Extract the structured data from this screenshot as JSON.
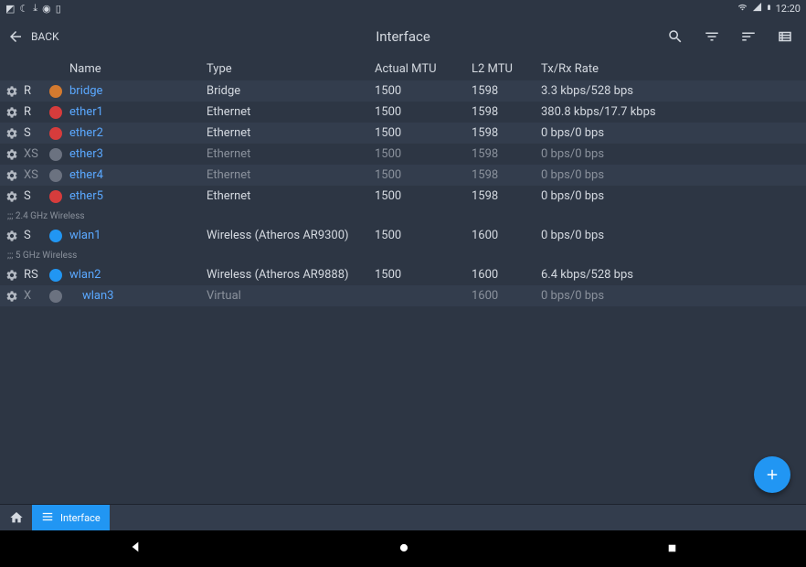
{
  "statusbar": {
    "time": "12:20"
  },
  "appbar": {
    "back": "BACK",
    "title": "Interface"
  },
  "columns": {
    "name": "Name",
    "type": "Type",
    "mtu": "Actual MTU",
    "l2": "L2 MTU",
    "rate": "Tx/Rx Rate"
  },
  "sections": {
    "s24": ";;; 2.4 GHz Wireless",
    "s5": ";;; 5 GHz Wireless"
  },
  "rows": [
    {
      "status": "R",
      "name": "bridge",
      "type": "Bridge",
      "mtu": "1500",
      "l2": "1598",
      "rate": "3.3 kbps/528 bps",
      "icon": "orange",
      "indent": false,
      "muted": false
    },
    {
      "status": "R",
      "name": "ether1",
      "type": "Ethernet",
      "mtu": "1500",
      "l2": "1598",
      "rate": "380.8 kbps/17.7 kbps",
      "icon": "red",
      "indent": false,
      "muted": false
    },
    {
      "status": "S",
      "name": "ether2",
      "type": "Ethernet",
      "mtu": "1500",
      "l2": "1598",
      "rate": "0 bps/0 bps",
      "icon": "red",
      "indent": false,
      "muted": false
    },
    {
      "status": "XS",
      "name": "ether3",
      "type": "Ethernet",
      "mtu": "1500",
      "l2": "1598",
      "rate": "0 bps/0 bps",
      "icon": "grey",
      "indent": false,
      "muted": true
    },
    {
      "status": "XS",
      "name": "ether4",
      "type": "Ethernet",
      "mtu": "1500",
      "l2": "1598",
      "rate": "0 bps/0 bps",
      "icon": "grey",
      "indent": false,
      "muted": true
    },
    {
      "status": "S",
      "name": "ether5",
      "type": "Ethernet",
      "mtu": "1500",
      "l2": "1598",
      "rate": "0 bps/0 bps",
      "icon": "red",
      "indent": false,
      "muted": false
    },
    {
      "status": "S",
      "name": "wlan1",
      "type": "Wireless (Atheros AR9300)",
      "mtu": "1500",
      "l2": "1600",
      "rate": "0 bps/0 bps",
      "icon": "blue",
      "indent": false,
      "muted": false
    },
    {
      "status": "RS",
      "name": "wlan2",
      "type": "Wireless (Atheros AR9888)",
      "mtu": "1500",
      "l2": "1600",
      "rate": "6.4 kbps/528 bps",
      "icon": "blue",
      "indent": false,
      "muted": false
    },
    {
      "status": "X",
      "name": "wlan3",
      "type": "Virtual",
      "mtu": "",
      "l2": "1600",
      "rate": "0 bps/0 bps",
      "icon": "grey",
      "indent": true,
      "muted": true
    }
  ],
  "tabs": {
    "interface": "Interface"
  }
}
